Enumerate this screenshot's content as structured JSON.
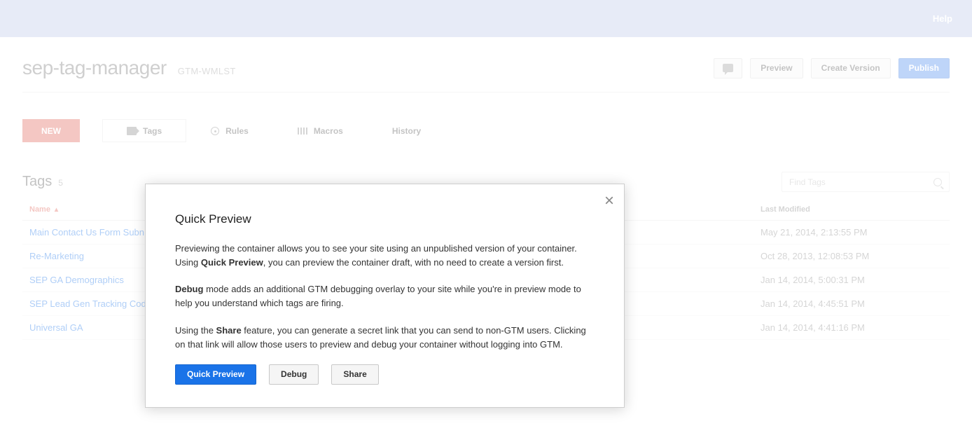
{
  "topbar": {
    "help": "Help"
  },
  "header": {
    "title": "sep-tag-manager",
    "containerId": "GTM-WMLST",
    "preview": "Preview",
    "createVersion": "Create Version",
    "publish": "Publish"
  },
  "nav": {
    "new": "NEW",
    "tags": "Tags",
    "rules": "Rules",
    "macros": "Macros",
    "history": "History"
  },
  "tagsSection": {
    "title": "Tags",
    "count": "5",
    "findPlaceholder": "Find Tags",
    "colName": "Name",
    "colMod": "Last Modified",
    "rows": [
      {
        "name": "Main Contact Us Form Subn",
        "mod": "May 21, 2014, 2:13:55 PM"
      },
      {
        "name": "Re-Marketing",
        "mod": "Oct 28, 2013, 12:08:53 PM"
      },
      {
        "name": "SEP GA Demographics",
        "mod": "Jan 14, 2014, 5:00:31 PM"
      },
      {
        "name": "SEP Lead Gen Tracking Cod",
        "mod": "Jan 14, 2014, 4:45:51 PM"
      },
      {
        "name": "Universal GA",
        "mod": "Jan 14, 2014, 4:41:16 PM"
      }
    ]
  },
  "modal": {
    "title": "Quick Preview",
    "para1_a": "Previewing the container allows you to see your site using an unpublished version of your container. Using ",
    "para1_b": "Quick Preview",
    "para1_c": ", you can preview the container draft, with no need to create a version first.",
    "para2_a": "Debug",
    "para2_b": " mode adds an additional GTM debugging overlay to your site while you're in preview mode to help you understand which tags are firing.",
    "para3_a": "Using the ",
    "para3_b": "Share",
    "para3_c": " feature, you can generate a secret link that you can send to non-GTM users. Clicking on that link will allow those users to preview and debug your container without logging into GTM.",
    "btnQuick": "Quick Preview",
    "btnDebug": "Debug",
    "btnShare": "Share"
  }
}
